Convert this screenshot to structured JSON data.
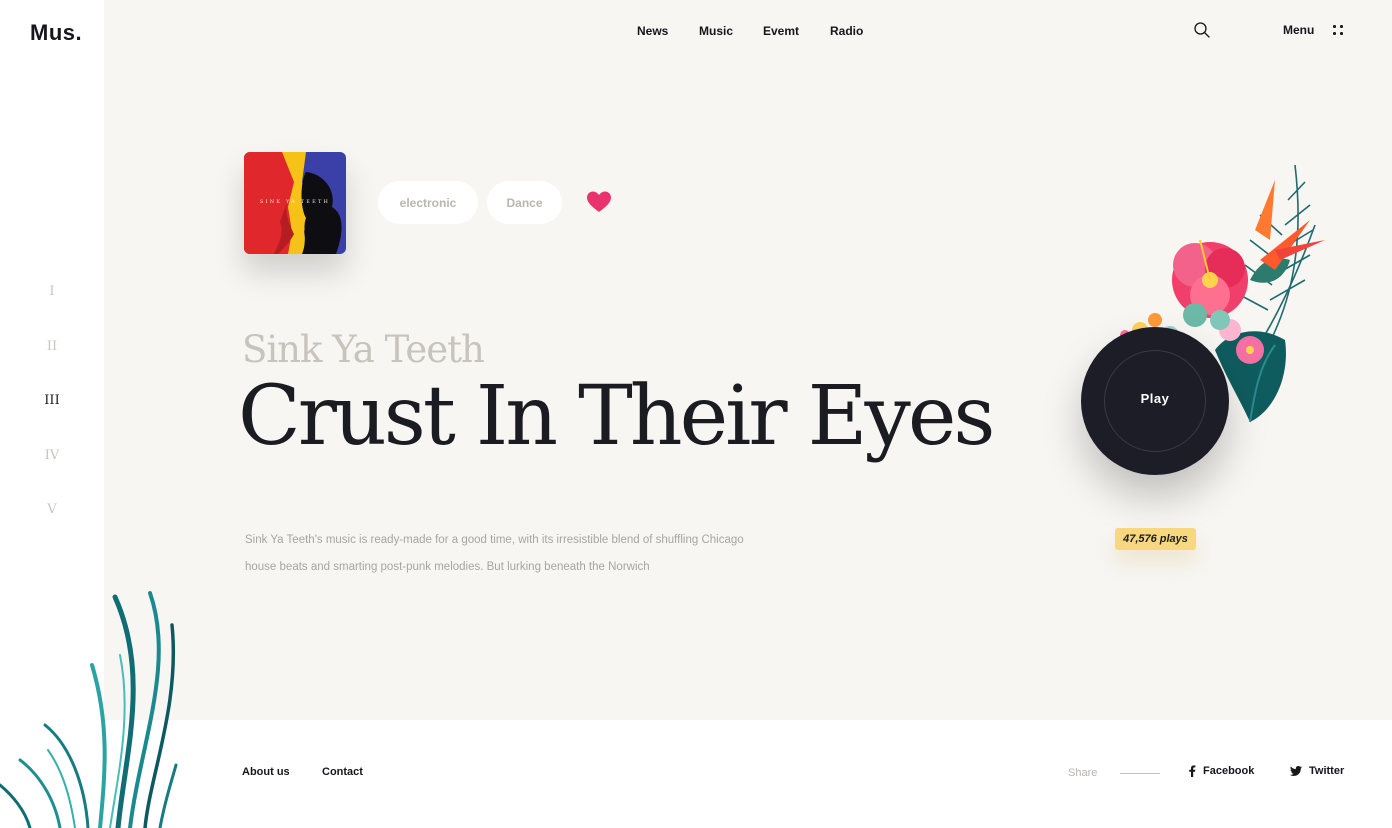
{
  "brand": {
    "logo": "Mus."
  },
  "nav": {
    "items": [
      "News",
      "Music",
      "Evemt",
      "Radio"
    ],
    "menu_label": "Menu"
  },
  "sidebar": {
    "sections": [
      "I",
      "II",
      "III",
      "IV",
      "V"
    ],
    "active_section": "III"
  },
  "album": {
    "cover_text": "SINK YA TEETH",
    "tags": [
      "electronic",
      "Dance"
    ],
    "favorited": true
  },
  "track": {
    "artist": "Sink Ya Teeth",
    "title": "Crust In Their Eyes",
    "description": "Sink Ya Teeth's music is ready-made for a good time, with its irresistible blend of shuffling Chicago house beats and smarting post-punk melodies. But lurking beneath the Norwich",
    "play_label": "Play",
    "plays": "47,576 plays"
  },
  "footer": {
    "links": [
      "About us",
      "Contact"
    ],
    "share_label": "Share",
    "social": [
      "Facebook",
      "Twitter"
    ]
  },
  "colors": {
    "background": "#f7f6f3",
    "accent_heart": "#e8336f",
    "plays_badge": "#f8d87e",
    "dark": "#1d1d27"
  },
  "icons": [
    "search-icon",
    "menu-dots-icon",
    "heart-icon",
    "facebook-icon",
    "twitter-icon"
  ]
}
